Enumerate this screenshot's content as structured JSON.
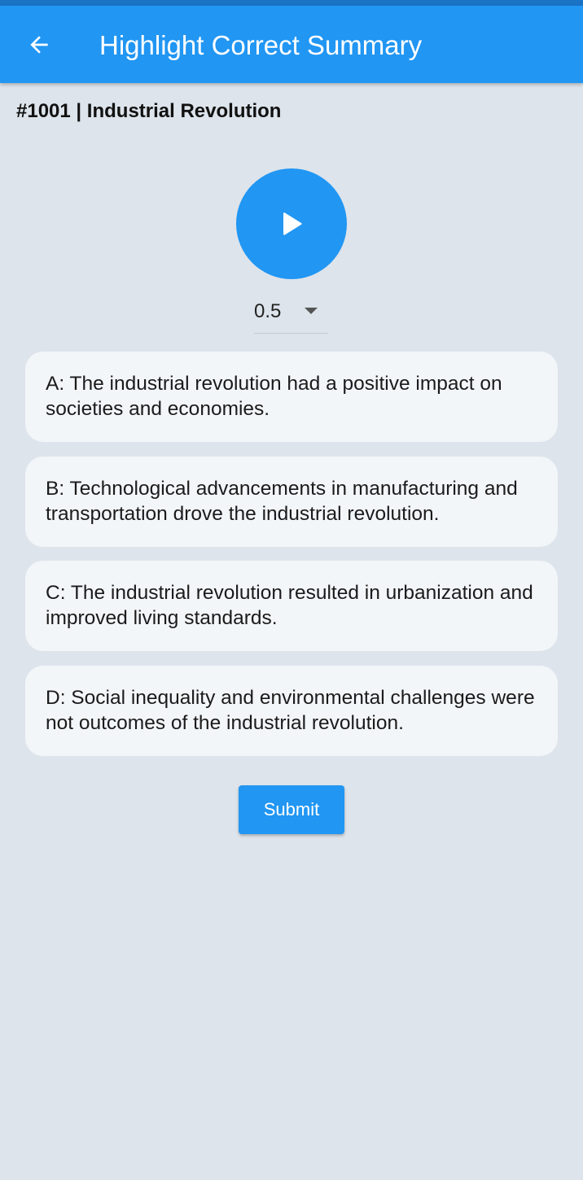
{
  "app_bar": {
    "title": "Highlight Correct Summary",
    "back_icon": "arrow-left-icon",
    "color": "#2196f3"
  },
  "question": {
    "title": "#1001 | Industrial Revolution"
  },
  "player": {
    "play_icon": "play-icon",
    "speed": {
      "selected": "0.5",
      "caret_icon": "caret-down-icon"
    }
  },
  "options": [
    {
      "text": "A: The industrial revolution had a positive impact on societies and economies."
    },
    {
      "text": "B: Technological advancements in manufacturing and transportation drove the industrial revolution."
    },
    {
      "text": "C: The industrial revolution resulted in urbanization and improved living standards."
    },
    {
      "text": "D: Social inequality and environmental challenges were not outcomes of the industrial revolution."
    }
  ],
  "submit": {
    "label": "Submit"
  }
}
